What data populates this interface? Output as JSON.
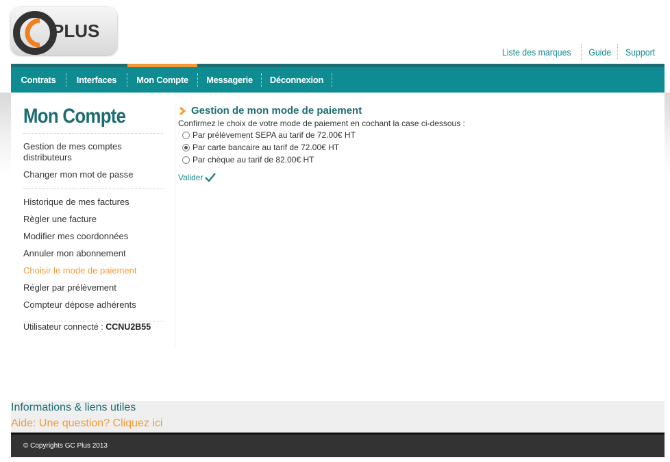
{
  "logo": {
    "text_gc": "GC",
    "text_plus": "PLUS"
  },
  "top_links": [
    "Liste des marques",
    "Guide",
    "Support"
  ],
  "nav": {
    "items": [
      "Contrats",
      "Interfaces",
      "Mon Compte",
      "Messagerie",
      "Déconnexion"
    ],
    "active": "Mon Compte"
  },
  "sidebar": {
    "title": "Mon Compte",
    "group1": [
      "Gestion de mes comptes distributeurs",
      "Changer mon mot de passe"
    ],
    "group2": [
      "Historique de mes factures",
      "Règler une facture",
      "Modifier mes coordonnées",
      "Annuler mon abonnement",
      "Choisir le mode de paiement",
      "Régler par prélèvement",
      "Compteur dépose adhérents"
    ],
    "active": "Choisir le mode de paiement",
    "user_label": "Utilisateur connecté :",
    "user_value": "CCNU2B55"
  },
  "main": {
    "title": "Gestion de mon mode de paiement",
    "instruction": "Confirmez le choix de votre mode de paiement en cochant la case ci-dessous :",
    "options": [
      {
        "label": "Par prélèvement SEPA au tarif de 72.00€ HT",
        "selected": false
      },
      {
        "label": "Par carte bancaire au tarif de 72.00€ HT",
        "selected": true
      },
      {
        "label": "Par chèque au tarif de 82.00€ HT",
        "selected": false
      }
    ],
    "validate_label": "Valider"
  },
  "footer": {
    "info_title": "Informations & liens utiles",
    "help_link": "Aide: Une question? Cliquez ici",
    "copyright": "© Copyrights GC Plus 2013"
  },
  "colors": {
    "teal": "#0e8c92",
    "dark_teal": "#1d6c72",
    "orange": "#f29b38"
  }
}
